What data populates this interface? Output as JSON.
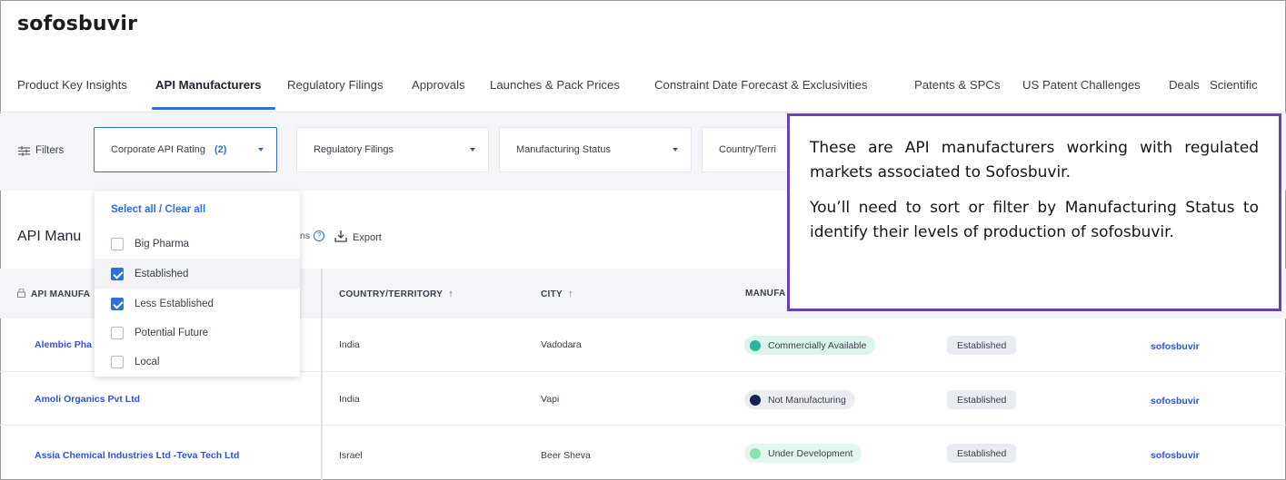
{
  "title": "sofosbuvir",
  "tabs": [
    {
      "label": "Product Key Insights"
    },
    {
      "label": "API Manufacturers"
    },
    {
      "label": "Regulatory Filings"
    },
    {
      "label": "Approvals"
    },
    {
      "label": "Launches & Pack Prices"
    },
    {
      "label": "Constraint Date Forecast & Exclusivities"
    },
    {
      "label": "Patents & SPCs"
    },
    {
      "label": "US Patent Challenges"
    },
    {
      "label": "Deals"
    },
    {
      "label": "Scientific"
    }
  ],
  "filters": {
    "label": "Filters",
    "corporate_api_rating": "Corporate API Rating",
    "corporate_api_rating_count": "(2)",
    "regulatory_filings": "Regulatory Filings",
    "manufacturing_status": "Manufacturing Status",
    "country_territory": "Country/Terri"
  },
  "dropdown": {
    "select_all": "Select all / Clear all",
    "options": [
      {
        "label": "Big Pharma",
        "checked": false
      },
      {
        "label": "Established",
        "checked": true
      },
      {
        "label": "Less Established",
        "checked": true
      },
      {
        "label": "Potential Future",
        "checked": false
      },
      {
        "label": "Local",
        "checked": false
      }
    ]
  },
  "section": {
    "title": "API Manu",
    "columns_suffix": "ns",
    "export": "Export"
  },
  "table": {
    "headers": {
      "manufacturer": "API MANUFA",
      "country": "COUNTRY/TERRITORY",
      "city": "CITY",
      "status": "MANUFA",
      "sort_arrow": "↑"
    },
    "rows": [
      {
        "manufacturer": "Alembic Pha",
        "country": "India",
        "city": "Vadodara",
        "status": "Commercially Available",
        "rating": "Established",
        "product": "sofosbuvir"
      },
      {
        "manufacturer": "Amoli Organics Pvt Ltd",
        "country": "India",
        "city": "Vapi",
        "status": "Not Manufacturing",
        "rating": "Established",
        "product": "sofosbuvir"
      },
      {
        "manufacturer": "Assia Chemical Industries Ltd -Teva Tech Ltd",
        "country": "Israel",
        "city": "Beer Sheva",
        "status": "Under Development",
        "rating": "Established",
        "product": "sofosbuvir"
      }
    ]
  },
  "status_colors": {
    "commercially_available": "#26b89a",
    "not_manufacturing": "#142357",
    "under_development": "#8ee0b0"
  },
  "accent_color": "#2f6fd6",
  "callout": {
    "paragraph1": "These are API manufacturers working with regulated markets associated to Sofosbuvir.",
    "paragraph2": "You’ll need to sort or filter by Manufacturing Status to identify their levels of production of sofosbuvir."
  }
}
